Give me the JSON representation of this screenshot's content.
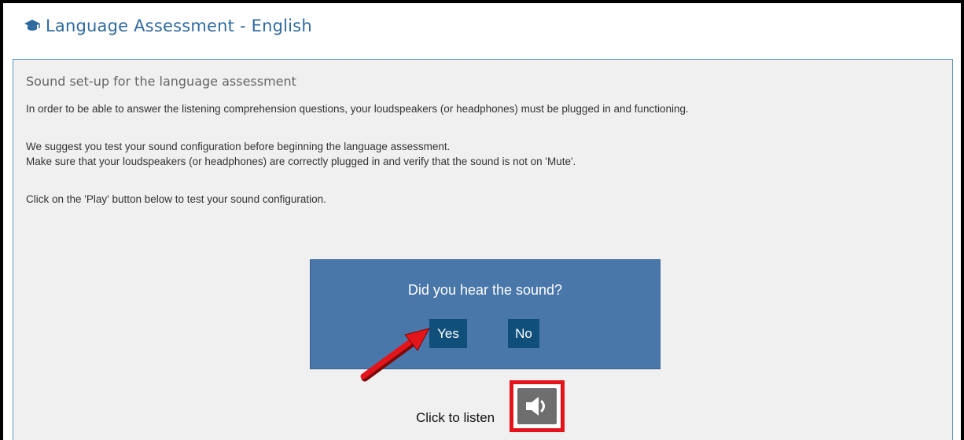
{
  "header": {
    "title": "Language Assessment - English",
    "icon": "graduation-cap-icon"
  },
  "panel": {
    "subtitle": "Sound set-up for the language assessment",
    "paragraphs": [
      "In order to be able to answer the listening comprehension questions, your loudspeakers (or headphones) must be plugged in and functioning.",
      "We suggest you test your sound configuration before beginning the language assessment.",
      "Make sure that your loudspeakers (or headphones) are correctly plugged in and verify that the sound is not on 'Mute'.",
      "Click on the 'Play' button below to test your sound configuration."
    ]
  },
  "dialog": {
    "question": "Did you hear the sound?",
    "yes_label": "Yes",
    "no_label": "No"
  },
  "audio": {
    "listen_label": "Click to listen",
    "icon": "speaker-icon"
  },
  "colors": {
    "accent": "#2f6a9e",
    "dialog_bg": "#4a77aa",
    "button_bg": "#0f4f7a",
    "highlight": "#e4141b"
  }
}
